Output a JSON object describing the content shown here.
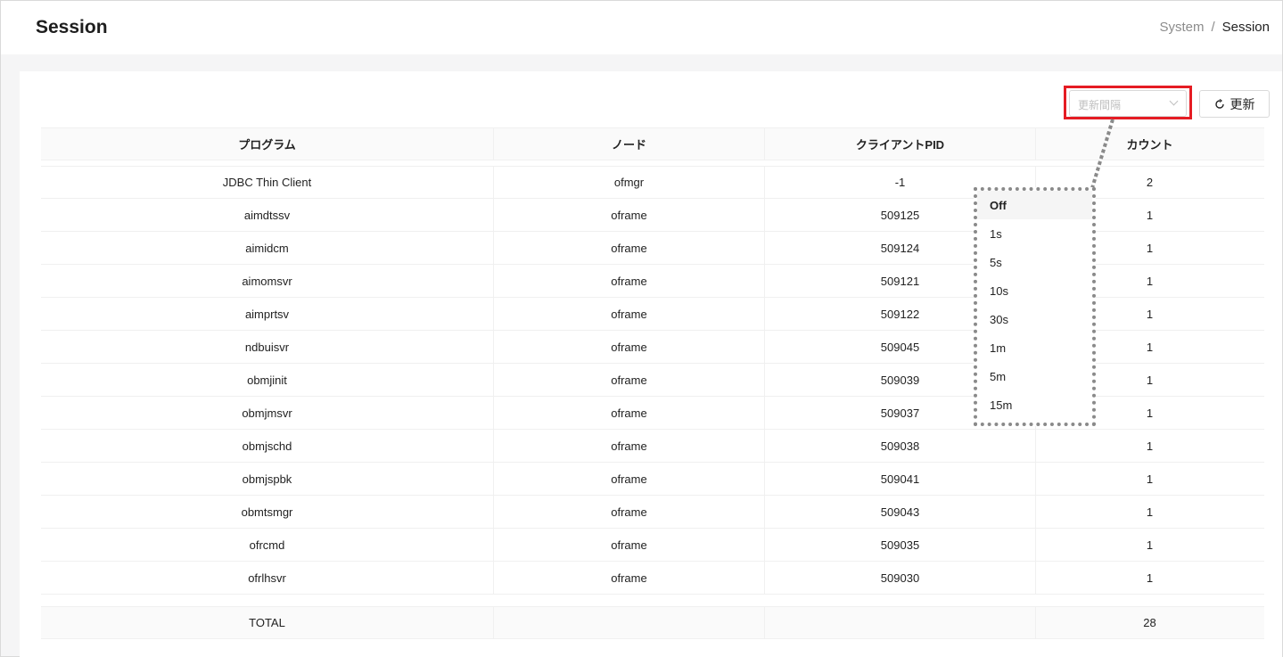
{
  "header": {
    "title": "Session",
    "breadcrumb": [
      "System",
      "/",
      "Session"
    ]
  },
  "toolbar": {
    "interval_placeholder": "更新間隔",
    "refresh_label": "更新"
  },
  "table": {
    "columns": [
      "プログラム",
      "ノード",
      "クライアントPID",
      "カウント"
    ],
    "rows": [
      [
        "JDBC Thin Client",
        "ofmgr",
        "-1",
        "2"
      ],
      [
        "aimdtssv",
        "oframe",
        "509125",
        "1"
      ],
      [
        "aimidcm",
        "oframe",
        "509124",
        "1"
      ],
      [
        "aimomsvr",
        "oframe",
        "509121",
        "1"
      ],
      [
        "aimprtsv",
        "oframe",
        "509122",
        "1"
      ],
      [
        "ndbuisvr",
        "oframe",
        "509045",
        "1"
      ],
      [
        "obmjinit",
        "oframe",
        "509039",
        "1"
      ],
      [
        "obmjmsvr",
        "oframe",
        "509037",
        "1"
      ],
      [
        "obmjschd",
        "oframe",
        "509038",
        "1"
      ],
      [
        "obmjspbk",
        "oframe",
        "509041",
        "1"
      ],
      [
        "obmtsmgr",
        "oframe",
        "509043",
        "1"
      ],
      [
        "ofrcmd",
        "oframe",
        "509035",
        "1"
      ],
      [
        "ofrlhsvr",
        "oframe",
        "509030",
        "1"
      ]
    ],
    "footer": [
      "TOTAL",
      "",
      "",
      "28"
    ]
  },
  "interval_dropdown": {
    "options": [
      "Off",
      "1s",
      "5s",
      "10s",
      "30s",
      "1m",
      "5m",
      "15m"
    ],
    "selected": "Off"
  },
  "colors": {
    "highlight": "#e51c23",
    "callout": "#8a8a8a"
  }
}
